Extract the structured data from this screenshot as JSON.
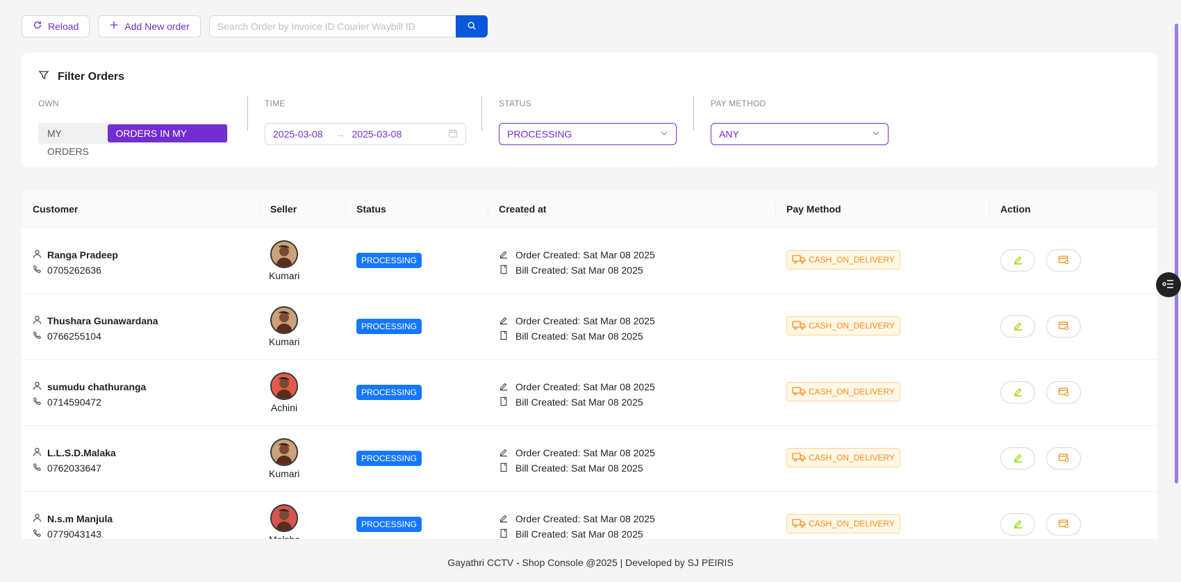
{
  "toolbar": {
    "reload_label": "Reload",
    "add_label": "Add New order",
    "search_placeholder": "Search Order by Invoice ID Courier Waybill ID"
  },
  "filter": {
    "title": "Filter Orders",
    "own": {
      "label": "OWN",
      "options": [
        "MY ORDERS",
        "ORDERS IN MY BRANCH"
      ],
      "selected": "ORDERS IN MY BRANCH"
    },
    "time": {
      "label": "TIME",
      "start": "2025-03-08",
      "end": "2025-03-08"
    },
    "status": {
      "label": "STATUS",
      "value": "PROCESSING"
    },
    "pay_method": {
      "label": "PAY METHOD",
      "value": "ANY"
    }
  },
  "table": {
    "columns": [
      "Customer",
      "Seller",
      "Status",
      "Created at",
      "Pay Method",
      "Action"
    ],
    "rows": [
      {
        "name": "Ranga Pradeep",
        "phone": "0705262636",
        "seller": "Kumari",
        "status": "PROCESSING",
        "order_created": "Order Created: Sat Mar 08 2025",
        "bill_created": "Bill Created: Sat Mar 08 2025",
        "pay": "CASH_ON_DELIVERY"
      },
      {
        "name": "Thushara Gunawardana",
        "phone": "0766255104",
        "seller": "Kumari",
        "status": "PROCESSING",
        "order_created": "Order Created: Sat Mar 08 2025",
        "bill_created": "Bill Created: Sat Mar 08 2025",
        "pay": "CASH_ON_DELIVERY"
      },
      {
        "name": "sumudu chathuranga",
        "phone": "0714590472",
        "seller": "Achini",
        "status": "PROCESSING",
        "order_created": "Order Created: Sat Mar 08 2025",
        "bill_created": "Bill Created: Sat Mar 08 2025",
        "pay": "CASH_ON_DELIVERY"
      },
      {
        "name": "L.L.S.D.Malaka",
        "phone": "0762033647",
        "seller": "Kumari",
        "status": "PROCESSING",
        "order_created": "Order Created: Sat Mar 08 2025",
        "bill_created": "Bill Created: Sat Mar 08 2025",
        "pay": "CASH_ON_DELIVERY"
      },
      {
        "name": "N.s.m Manjula",
        "phone": "0779043143",
        "seller": "Malsha",
        "status": "PROCESSING",
        "order_created": "Order Created: Sat Mar 08 2025",
        "bill_created": "Bill Created: Sat Mar 08 2025",
        "pay": "CASH_ON_DELIVERY"
      }
    ]
  },
  "footer": {
    "text": "Gayathri CCTV - Shop Console @2025 | Developed by SJ PEIRIS"
  },
  "colors": {
    "accent": "#722ed1",
    "primary": "#0958d9",
    "status_blue": "#1677ff",
    "cod_orange": "#fa8c16"
  }
}
